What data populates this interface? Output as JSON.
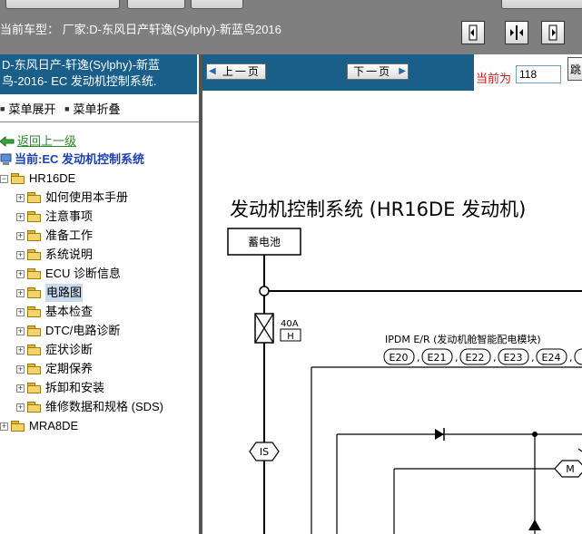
{
  "header": {
    "car_model_label": "当前车型：",
    "car_model_value": "厂家:D-东风日产轩逸(Sylphy)-新蓝鸟2016"
  },
  "view_buttons": [
    {
      "name": "single-page-view",
      "icon": "single-page-icon"
    },
    {
      "name": "fit-width-view",
      "icon": "fit-width-icon"
    },
    {
      "name": "two-page-view",
      "icon": "two-page-icon"
    }
  ],
  "sidebar": {
    "title_line1": "D-东风日产-轩逸(Sylphy)-新蓝",
    "title_line2": "鸟-2016- EC 发动机控制系统.",
    "expand_label": "菜单展开",
    "collapse_label": "菜单折叠",
    "back_label": "返回上一级",
    "current_label": "当前:EC 发动机控制系统",
    "root": "HR16DE",
    "items": [
      {
        "label": "如何使用本手册"
      },
      {
        "label": "注意事项"
      },
      {
        "label": "准备工作"
      },
      {
        "label": "系统说明"
      },
      {
        "label": "ECU 诊断信息"
      },
      {
        "label": "电路图",
        "selected": true
      },
      {
        "label": "基本检查"
      },
      {
        "label": "DTC/电路诊断"
      },
      {
        "label": "症状诊断"
      },
      {
        "label": "定期保养"
      },
      {
        "label": "拆卸和安装"
      },
      {
        "label": "维修数据和规格 (SDS)"
      }
    ],
    "root2": "MRA8DE"
  },
  "pager": {
    "prev_label": "上一页",
    "next_label": "下一页",
    "current_label": "当前为",
    "current_page": "118",
    "jump_label": "跳"
  },
  "diagram": {
    "title": "发动机控制系统 (HR16DE 发动机)",
    "battery_label": "蓄电池",
    "fuse_rating": "40A",
    "fuse_code": "H",
    "ipdm_label": "IPDM E/R (发动机舱智能配电模块)",
    "connectors": [
      "E20",
      "E21",
      "E22",
      "E23",
      "E24"
    ],
    "is_label": "IS",
    "m_label": "M"
  },
  "colors": {
    "topbar": "#7f7f7f",
    "panel_header": "#1a5e8a",
    "link_green": "#2a8a2a",
    "current_blue": "#1b3fb5",
    "page_label_red": "#cc1b1b"
  }
}
